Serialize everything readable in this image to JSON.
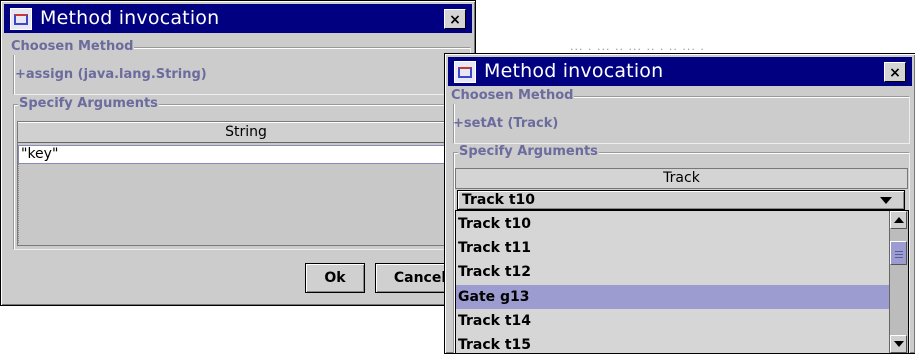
{
  "bg_fragment": "··· · ··· ·· ··· ·· · ·· ··· ·",
  "dialog1": {
    "title": "Method invocation",
    "close_label": "×",
    "chosen_method_label": "Choosen Method",
    "method_signature": "+assign (java.lang.String)",
    "specify_arguments_label": "Specify Arguments",
    "table": {
      "column_header": "String",
      "cell_value": "\"key\""
    },
    "ok_label": "Ok",
    "cancel_label": "Cancel"
  },
  "dialog2": {
    "title": "Method invocation",
    "close_label": "×",
    "chosen_method_label": "Choosen Method",
    "method_signature": "+setAt (Track)",
    "specify_arguments_label": "Specify Arguments",
    "table": {
      "column_header": "Track",
      "selected_value": "Track t10"
    },
    "dropdown_items": [
      {
        "label": "Track t10",
        "selected": false
      },
      {
        "label": "Track t11",
        "selected": false
      },
      {
        "label": "Track t12",
        "selected": false
      },
      {
        "label": "Gate g13",
        "selected": true
      },
      {
        "label": "Track t14",
        "selected": false
      },
      {
        "label": "Track t15",
        "selected": false
      }
    ]
  },
  "colors": {
    "title_bar": "#000080",
    "window_bg": "#cccccc",
    "group_label": "#6b6b9e",
    "selection": "#9c9cd0"
  }
}
